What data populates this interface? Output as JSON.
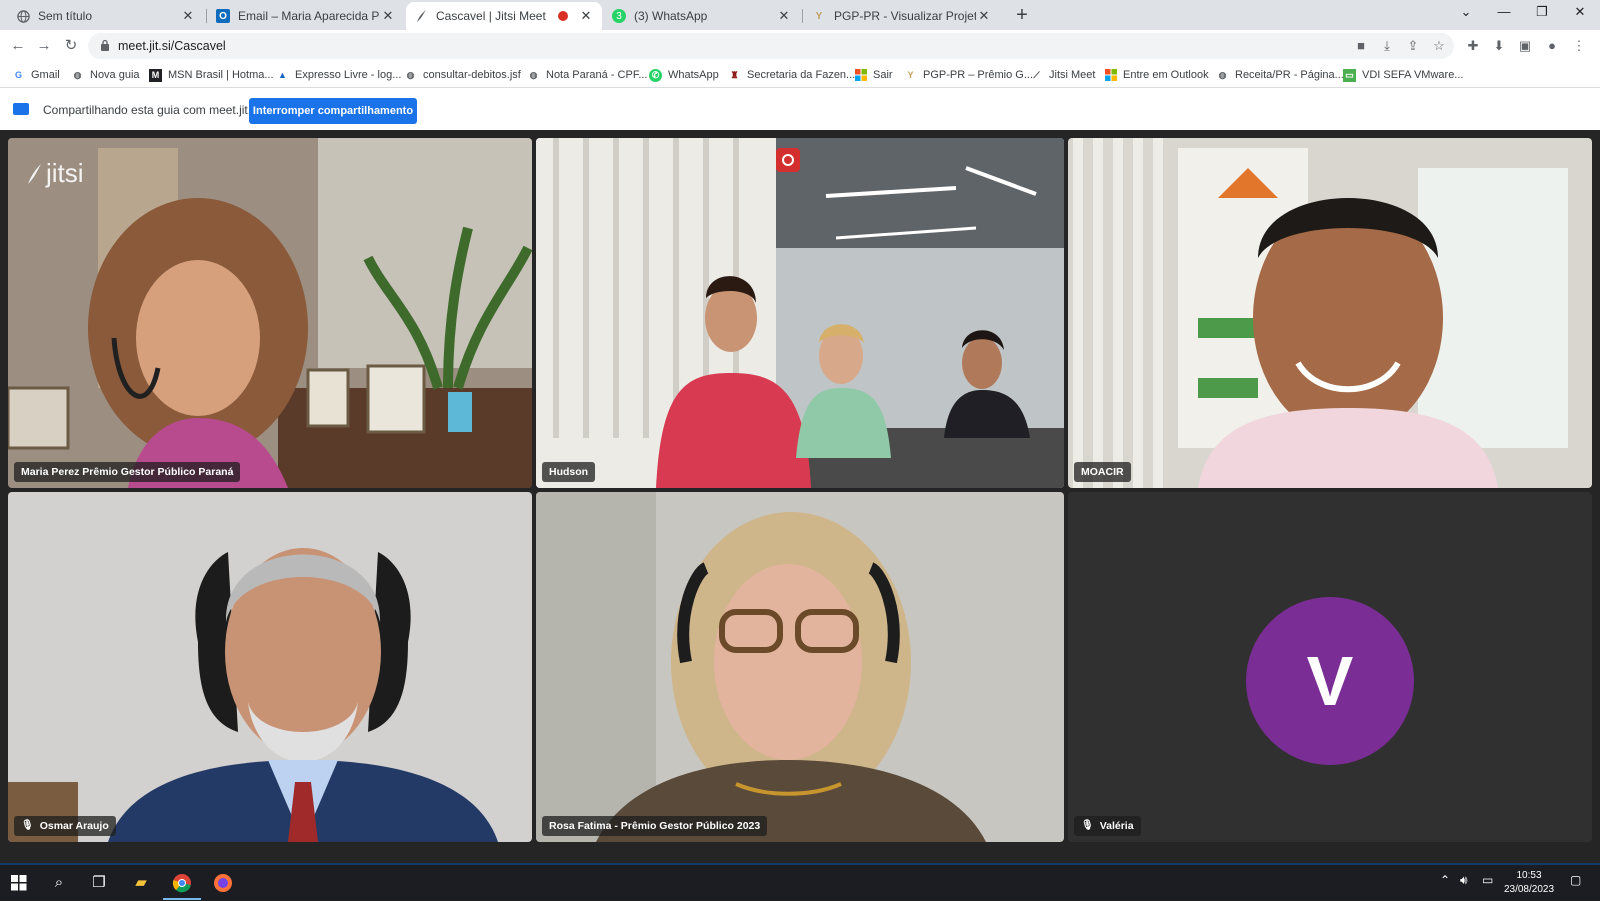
{
  "browser": {
    "tabs": [
      {
        "title": "Sem título",
        "icon": "globe-icon",
        "active": false
      },
      {
        "title": "Email – Maria Aparecida Perez N",
        "icon": "outlook-icon",
        "active": false
      },
      {
        "title": "Cascavel | Jitsi Meet",
        "icon": "jitsi-icon",
        "active": true,
        "recording": true
      },
      {
        "title": "(3) WhatsApp",
        "icon": "whatsapp-icon",
        "active": false
      },
      {
        "title": "PGP-PR - Visualizar Projeto",
        "icon": "pgp-icon",
        "active": false
      }
    ],
    "new_tab_label": "+",
    "address": "meet.jit.si/Cascavel"
  },
  "bookmarks": [
    {
      "label": "Gmail",
      "icon": "google-icon",
      "color": "#4285f4"
    },
    {
      "label": "Nova guia",
      "icon": "globe-icon",
      "color": "#5f6368"
    },
    {
      "label": "MSN Brasil | Hotma...",
      "icon": "msn-icon",
      "color": "#202124"
    },
    {
      "label": "Expresso Livre - log...",
      "icon": "expresso-icon",
      "color": "#1565c0"
    },
    {
      "label": "consultar-debitos.jsf",
      "icon": "globe-icon",
      "color": "#5f6368"
    },
    {
      "label": "Nota Paraná - CPF...",
      "icon": "globe-icon",
      "color": "#5f6368"
    },
    {
      "label": "WhatsApp",
      "icon": "whatsapp-icon",
      "color": "#25d366"
    },
    {
      "label": "Secretaria da Fazen...",
      "icon": "crest-icon",
      "color": "#8e1b1b"
    },
    {
      "label": "Sair",
      "icon": "microsoft-icon",
      "color": "#f25022"
    },
    {
      "label": "PGP-PR – Prêmio G...",
      "icon": "pgp-icon",
      "color": "#c0a060"
    },
    {
      "label": "Jitsi Meet",
      "icon": "jitsi-icon",
      "color": "#3c4043"
    },
    {
      "label": "Entre em Outlook",
      "icon": "microsoft-icon",
      "color": "#f25022"
    },
    {
      "label": "Receita/PR - Página...",
      "icon": "globe-icon",
      "color": "#5f6368"
    },
    {
      "label": "VDI SEFA VMware...",
      "icon": "vdi-icon",
      "color": "#4caf50"
    }
  ],
  "share_bar": {
    "text": "Compartilhando esta guia com meet.jit.si",
    "button": "Interromper compartilhamento"
  },
  "meeting": {
    "logo": "jitsi",
    "participants": [
      {
        "name": "Maria Perez Prêmio Gestor Público Paraná",
        "muted": false
      },
      {
        "name": "Hudson",
        "muted": false,
        "dominant": true
      },
      {
        "name": "MOACIR",
        "muted": false
      },
      {
        "name": "Osmar Araujo",
        "muted": true
      },
      {
        "name": "Rosa Fatima - Prêmio Gestor Público 2023",
        "muted": false
      },
      {
        "name": "Valéria",
        "muted": true,
        "avatar_letter": "V",
        "avatar_color": "#7b2d96"
      }
    ]
  },
  "taskbar": {
    "time": "10:53",
    "date": "23/08/2023"
  }
}
